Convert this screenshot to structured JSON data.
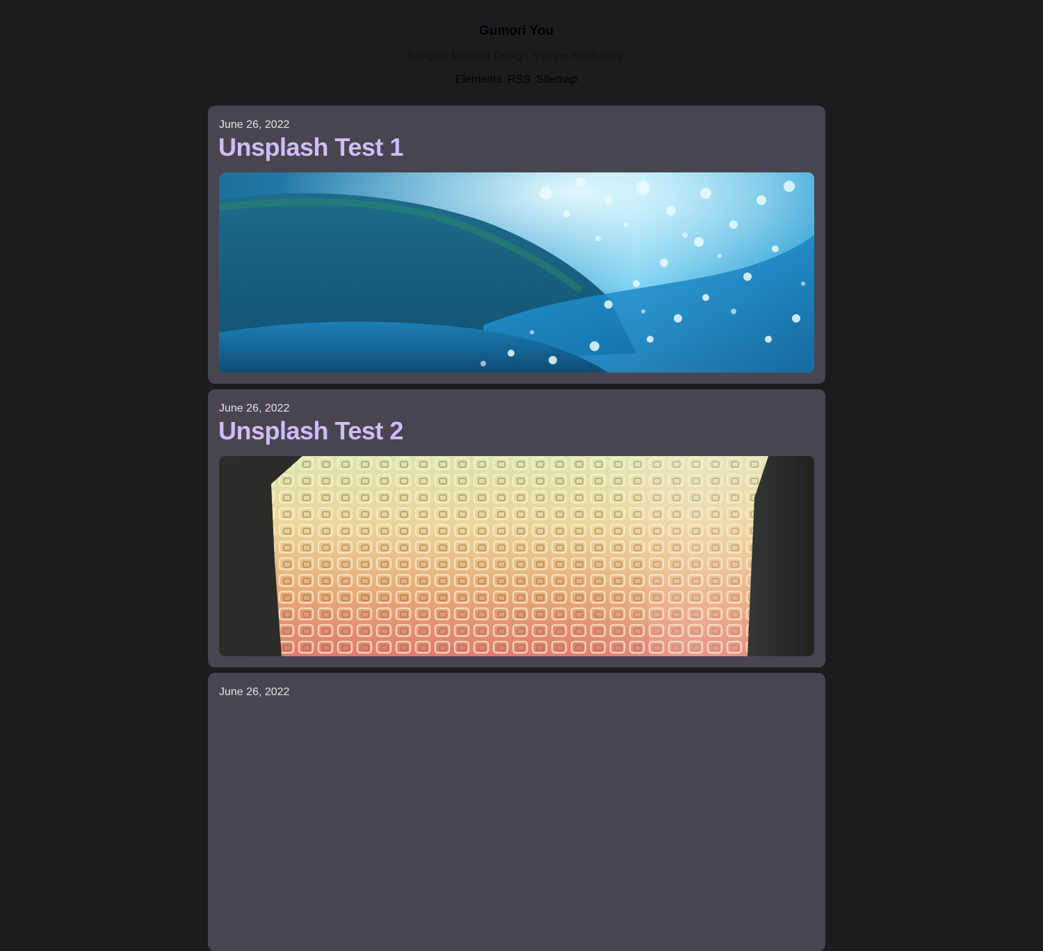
{
  "header": {
    "title": "Gumori You",
    "tagline": "Bringing Material Design 3 to the Astro Blog.",
    "nav": [
      "Elements",
      "RSS",
      "Sitemap"
    ]
  },
  "posts": [
    {
      "date": "June 26, 2022",
      "title": "Unsplash Test 1",
      "image": "ocean-water-photo"
    },
    {
      "date": "June 26, 2022",
      "title": "Unsplash Test 2",
      "image": "gradient-lattice-sculpture-photo"
    },
    {
      "date": "June 26, 2022",
      "title": "",
      "image": ""
    }
  ],
  "colors": {
    "background": "#1c1b1f",
    "card": "#49454f",
    "title": "#d0bcff",
    "date": "#e6e1e5"
  }
}
